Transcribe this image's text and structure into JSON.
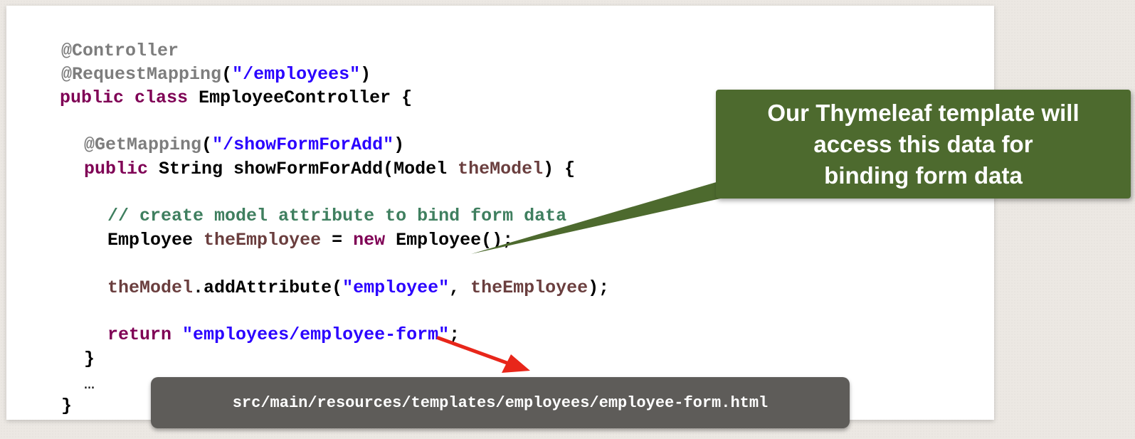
{
  "code": {
    "line1": {
      "annotation": "@Controller"
    },
    "line2": {
      "annotation": "@RequestMapping",
      "open": "(",
      "path": "\"/employees\"",
      "close": ")"
    },
    "line3": {
      "public": "public",
      "class": "class",
      "rest": " EmployeeController {"
    },
    "line5": {
      "annotation": "@GetMapping",
      "open": "(",
      "path": "\"/showFormForAdd\"",
      "close": ")"
    },
    "line6": {
      "public": "public",
      "mid": " String showFormForAdd(Model ",
      "param": "theModel",
      "close": ") {"
    },
    "line8": {
      "comment": "// create model attribute to bind form data"
    },
    "line9": {
      "type": "Employee ",
      "var": "theEmployee",
      "eq": " = ",
      "new": "new",
      "rest": " Employee();"
    },
    "line11": {
      "var": "theModel",
      "method": ".addAttribute(",
      "str": "\"employee\"",
      "comma": ", ",
      "arg": "theEmployee",
      "close": ");"
    },
    "line13": {
      "return": "return",
      "space": " ",
      "str": "\"employees/employee-form\"",
      "semi": ";"
    },
    "line14": {
      "brace": "}"
    },
    "line15": {
      "ellipsis": "…"
    },
    "line16": {
      "brace": "}"
    }
  },
  "callout": {
    "line1": "Our Thymeleaf template will",
    "line2": "access this data for",
    "line3": "binding form data",
    "color": "#4d6a2e"
  },
  "path_label": "src/main/resources/templates/employees/employee-form.html",
  "colors": {
    "annotation": "#7d7d7d",
    "string": "#2a00ff",
    "keyword": "#7f0055",
    "variable": "#6a3e3e",
    "comment": "#3f7f5f",
    "arrow": "#e8261a"
  }
}
